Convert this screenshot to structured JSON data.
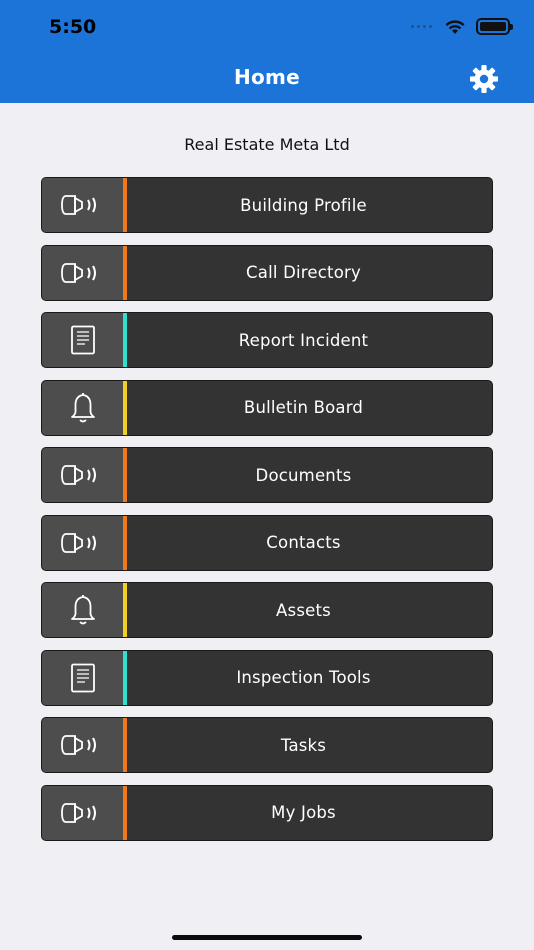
{
  "status_bar": {
    "time": "5:50"
  },
  "nav": {
    "title": "Home",
    "settings_icon": "gear-icon"
  },
  "company_name": "Real Estate Meta Ltd",
  "colors": {
    "header": "#1d74d8",
    "orange": "#f07a1a",
    "teal": "#2fdfcf",
    "yellow": "#f2cf22"
  },
  "menu": [
    {
      "label": "Building Profile",
      "icon": "speaker-icon",
      "accent": "orange"
    },
    {
      "label": "Call Directory",
      "icon": "speaker-icon",
      "accent": "orange"
    },
    {
      "label": "Report Incident",
      "icon": "document-icon",
      "accent": "teal"
    },
    {
      "label": "Bulletin Board",
      "icon": "bell-icon",
      "accent": "yellow"
    },
    {
      "label": "Documents",
      "icon": "speaker-icon",
      "accent": "orange"
    },
    {
      "label": "Contacts",
      "icon": "speaker-icon",
      "accent": "orange"
    },
    {
      "label": "Assets",
      "icon": "bell-icon",
      "accent": "yellow"
    },
    {
      "label": "Inspection Tools",
      "icon": "document-icon",
      "accent": "teal"
    },
    {
      "label": "Tasks",
      "icon": "speaker-icon",
      "accent": "orange"
    },
    {
      "label": "My Jobs",
      "icon": "speaker-icon",
      "accent": "orange"
    }
  ]
}
